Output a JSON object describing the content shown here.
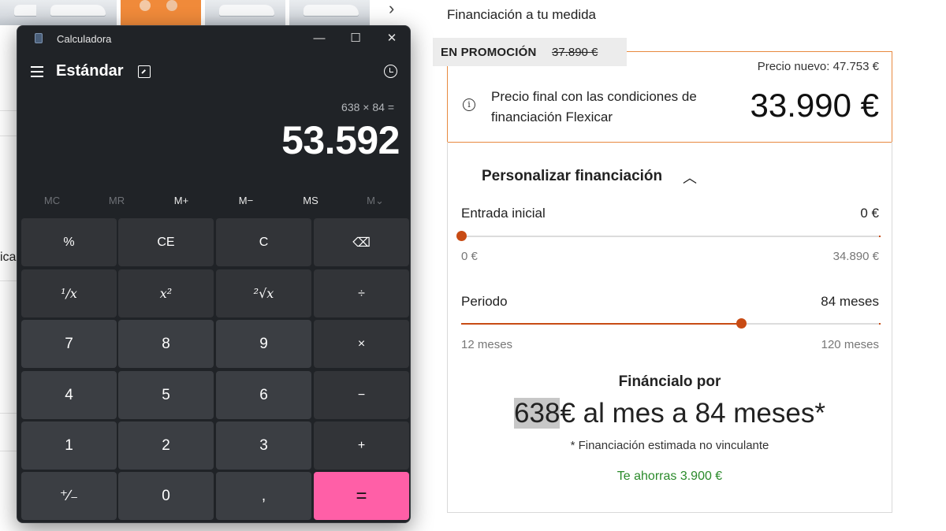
{
  "web": {
    "section_title": "Financiación a tu medida",
    "left_fragment": "ica",
    "promo": {
      "label": "EN PROMOCIÓN",
      "old_price": "37.890 €"
    },
    "price": {
      "new_price": "Precio nuevo: 47.753 €",
      "description": "Precio final con las condiciones de financiación Flexicar",
      "final_price": "33.990 €"
    },
    "customize": {
      "title": "Personalizar financiación",
      "down_payment": {
        "label": "Entrada inicial",
        "value": "0 €",
        "min": "0 €",
        "max": "34.890 €",
        "level": 0
      },
      "period": {
        "label": "Periodo",
        "value": "84 meses",
        "min": "12 meses",
        "max": "120 meses",
        "level": 0.667
      }
    },
    "financing": {
      "heading": "Fináncialo por",
      "amount_highlight": "638",
      "amount_rest": "€ al mes a 84 meses*",
      "note": "* Financiación estimada no vinculante",
      "savings": "Te ahorras 3.900 €"
    },
    "accent_color": "#c84b14",
    "border_color": "#e8893f",
    "savings_color": "#2a8a2a"
  },
  "calculator": {
    "title": "Calculadora",
    "mode": "Estándar",
    "expression": "638 × 84 =",
    "result": "53.592",
    "window_buttons": [
      "minimize-icon",
      "maximize-icon",
      "close-icon"
    ],
    "memory": {
      "mc": "MC",
      "mr": "MR",
      "mplus": "M+",
      "mminus": "M−",
      "ms": "MS",
      "mv": "M⌄"
    },
    "keys": {
      "percent": "%",
      "ce": "CE",
      "c": "C",
      "backspace": "⌫",
      "reciprocal": "¹∕x",
      "square": "x²",
      "sqrt": "²√x",
      "divide": "÷",
      "seven": "7",
      "eight": "8",
      "nine": "9",
      "multiply": "×",
      "four": "4",
      "five": "5",
      "six": "6",
      "minus": "−",
      "one": "1",
      "two": "2",
      "three": "3",
      "plus": "+",
      "negate": "⁺∕₋",
      "zero": "0",
      "decimal": ",",
      "equals": "="
    },
    "equals_color": "#ff5fa7"
  }
}
